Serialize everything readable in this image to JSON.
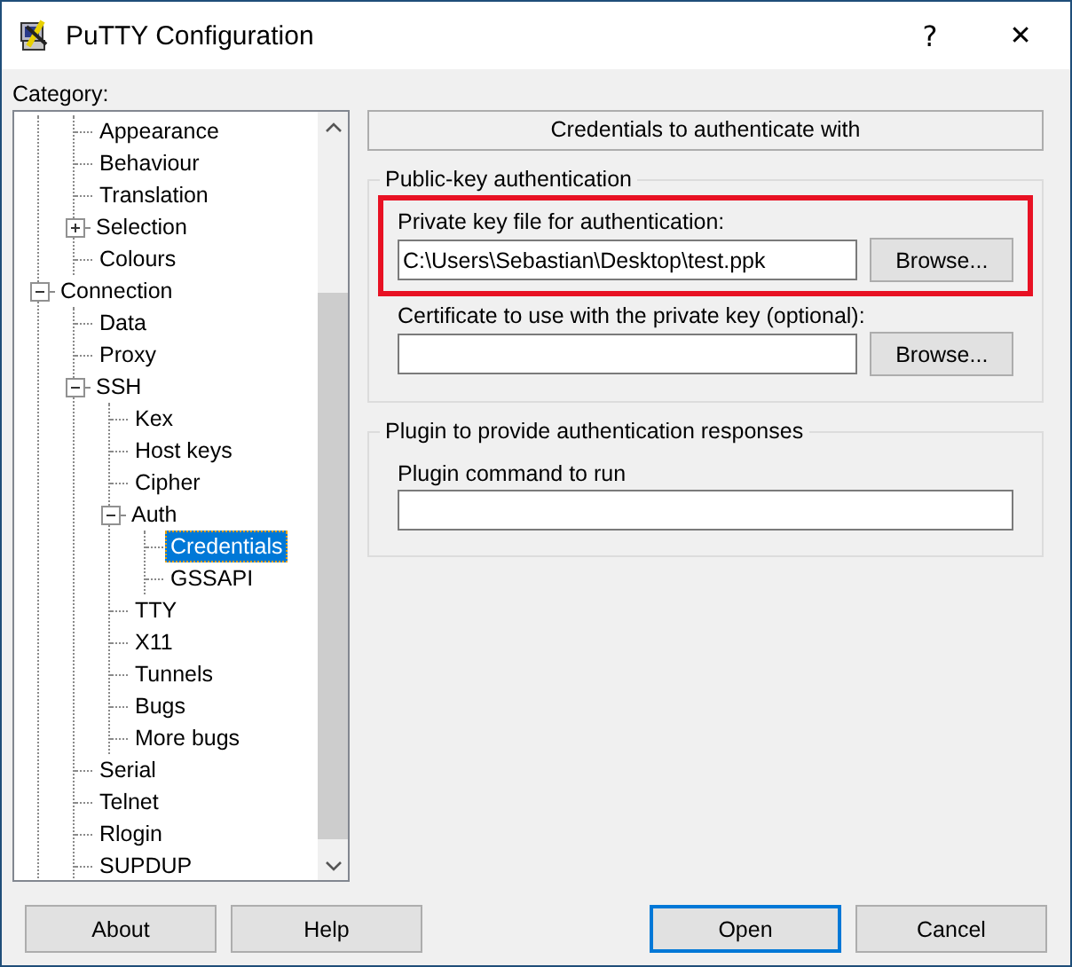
{
  "window": {
    "title": "PuTTY Configuration",
    "help": "?",
    "close": "✕"
  },
  "category": {
    "label": "Category:",
    "tree": [
      {
        "kind": "continued",
        "children": [
          {
            "label": "Appearance"
          },
          {
            "label": "Behaviour"
          },
          {
            "label": "Translation"
          },
          {
            "label": "Selection",
            "expanded": false
          },
          {
            "label": "Colours"
          }
        ]
      },
      {
        "label": "Connection",
        "expanded": true,
        "children": [
          {
            "label": "Data"
          },
          {
            "label": "Proxy"
          },
          {
            "label": "SSH",
            "expanded": true,
            "children": [
              {
                "label": "Kex"
              },
              {
                "label": "Host keys"
              },
              {
                "label": "Cipher"
              },
              {
                "label": "Auth",
                "expanded": true,
                "children": [
                  {
                    "label": "Credentials",
                    "selected": true
                  },
                  {
                    "label": "GSSAPI",
                    "selected": false
                  }
                ]
              },
              {
                "label": "TTY"
              },
              {
                "label": "X11"
              },
              {
                "label": "Tunnels"
              },
              {
                "label": "Bugs"
              },
              {
                "label": "More bugs"
              }
            ]
          },
          {
            "label": "Serial"
          },
          {
            "label": "Telnet"
          },
          {
            "label": "Rlogin"
          },
          {
            "label": "SUPDUP"
          }
        ]
      }
    ]
  },
  "panel": {
    "heading": "Credentials to authenticate with",
    "groups": [
      {
        "title": "Public-key authentication",
        "fields": [
          {
            "label": "Private key file for authentication:",
            "value": "C:\\Users\\Sebastian\\Desktop\\test.ppk",
            "button": "Browse...",
            "highlighted": true
          },
          {
            "label": "Certificate to use with the private key (optional):",
            "button": "Browse..."
          }
        ]
      },
      {
        "title": "Plugin to provide authentication responses",
        "fields": [
          {
            "label": "Plugin command to run"
          }
        ]
      }
    ]
  },
  "buttons": [
    {
      "label": "About",
      "default": false
    },
    {
      "label": "Help",
      "default": false
    },
    {
      "label": "Open",
      "default": true
    },
    {
      "label": "Cancel",
      "default": false
    }
  ]
}
